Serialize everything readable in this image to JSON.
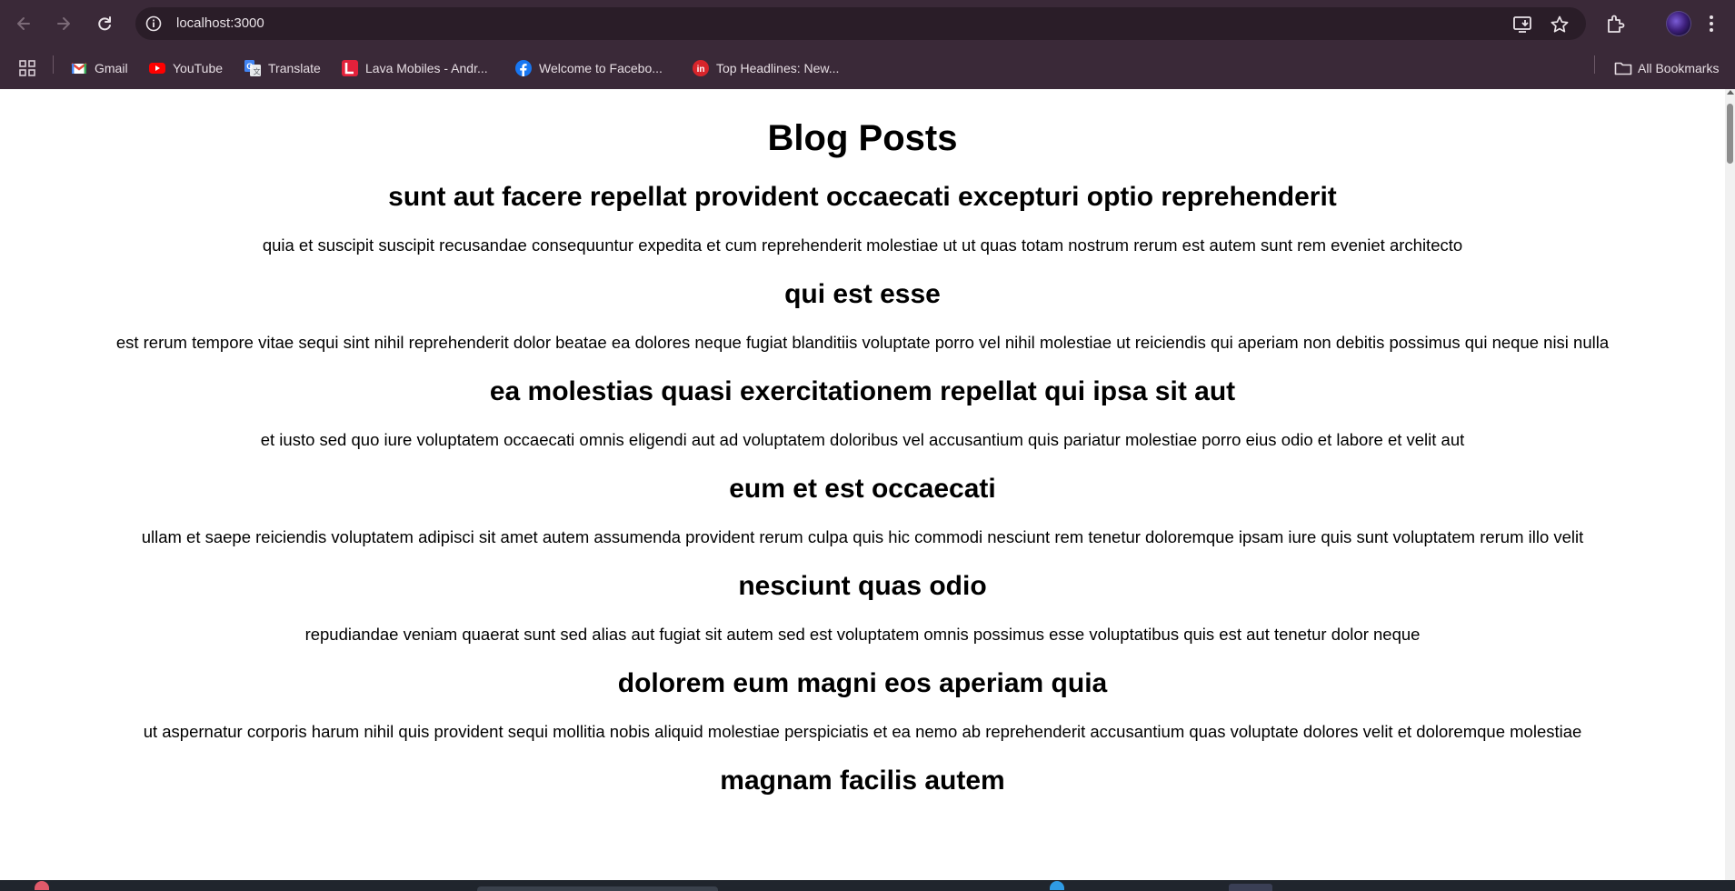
{
  "browser": {
    "url": "localhost:3000",
    "bookmarks": [
      {
        "label": "Gmail",
        "icon": "gmail-icon",
        "color": "#ea4335"
      },
      {
        "label": "YouTube",
        "icon": "youtube-icon",
        "color": "#ff0000"
      },
      {
        "label": "Translate",
        "icon": "translate-icon",
        "color": "#4285f4"
      },
      {
        "label": "Lava Mobiles - Andr...",
        "icon": "lava-icon",
        "color": "#e3213b"
      },
      {
        "label": "Welcome to Facebo...",
        "icon": "facebook-icon",
        "color": "#1877f2"
      },
      {
        "label": "Top Headlines: New...",
        "icon": "inshorts-icon",
        "color": "#d8252b"
      }
    ],
    "all_bookmarks_label": "All Bookmarks"
  },
  "page": {
    "title": "Blog Posts",
    "posts": [
      {
        "title": "sunt aut facere repellat provident occaecati excepturi optio reprehenderit",
        "body": "quia et suscipit suscipit recusandae consequuntur expedita et cum reprehenderit molestiae ut ut quas totam nostrum rerum est autem sunt rem eveniet architecto"
      },
      {
        "title": "qui est esse",
        "body": "est rerum tempore vitae sequi sint nihil reprehenderit dolor beatae ea dolores neque fugiat blanditiis voluptate porro vel nihil molestiae ut reiciendis qui aperiam non debitis possimus qui neque nisi nulla"
      },
      {
        "title": "ea molestias quasi exercitationem repellat qui ipsa sit aut",
        "body": "et iusto sed quo iure voluptatem occaecati omnis eligendi aut ad voluptatem doloribus vel accusantium quis pariatur molestiae porro eius odio et labore et velit aut"
      },
      {
        "title": "eum et est occaecati",
        "body": "ullam et saepe reiciendis voluptatem adipisci sit amet autem assumenda provident rerum culpa quis hic commodi nesciunt rem tenetur doloremque ipsam iure quis sunt voluptatem rerum illo velit"
      },
      {
        "title": "nesciunt quas odio",
        "body": "repudiandae veniam quaerat sunt sed alias aut fugiat sit autem sed est voluptatem omnis possimus esse voluptatibus quis est aut tenetur dolor neque"
      },
      {
        "title": "dolorem eum magni eos aperiam quia",
        "body": "ut aspernatur corporis harum nihil quis provident sequi mollitia nobis aliquid molestiae perspiciatis et ea nemo ab reprehenderit accusantium quas voluptate dolores velit et doloremque molestiae"
      },
      {
        "title": "magnam facilis autem",
        "body": ""
      }
    ]
  },
  "colors": {
    "chrome_bg": "#3a2938",
    "omnibox_bg": "#2a1d28",
    "page_bg": "#ffffff",
    "text": "#000000"
  }
}
